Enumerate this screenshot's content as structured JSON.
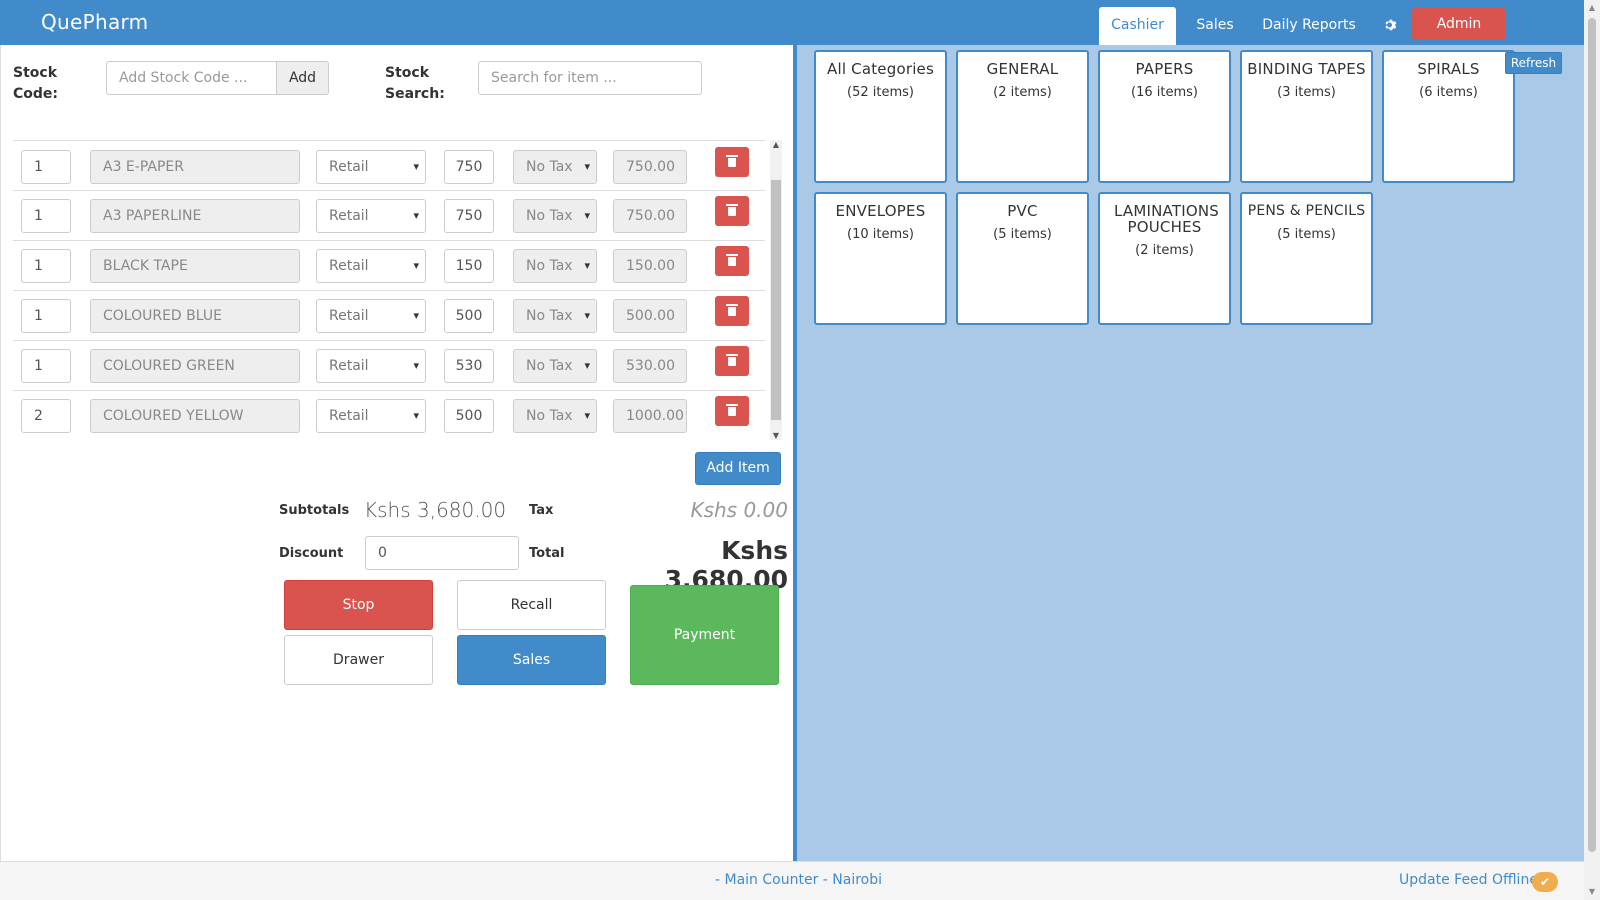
{
  "app": {
    "brand": "QuePharm"
  },
  "nav": {
    "tabs": [
      "Cashier",
      "Sales",
      "Daily Reports"
    ],
    "settings_icon": "gear-icon",
    "admin_label": "Admin"
  },
  "stock": {
    "code_label": "Stock Code:",
    "code_placeholder": "Add Stock Code ...",
    "add_label": "Add",
    "search_label": "Stock Search:",
    "search_placeholder": "Search for item ..."
  },
  "items": [
    {
      "qty": "1",
      "name": "A3 E-PAPER",
      "price_type": "Retail",
      "unit": "750",
      "tax": "No Tax",
      "total": "750.00"
    },
    {
      "qty": "1",
      "name": "A3 PAPERLINE",
      "price_type": "Retail",
      "unit": "750",
      "tax": "No Tax",
      "total": "750.00"
    },
    {
      "qty": "1",
      "name": "BLACK TAPE",
      "price_type": "Retail",
      "unit": "150",
      "tax": "No Tax",
      "total": "150.00"
    },
    {
      "qty": "1",
      "name": "COLOURED BLUE",
      "price_type": "Retail",
      "unit": "500",
      "tax": "No Tax",
      "total": "500.00"
    },
    {
      "qty": "1",
      "name": "COLOURED GREEN",
      "price_type": "Retail",
      "unit": "530",
      "tax": "No Tax",
      "total": "530.00"
    },
    {
      "qty": "2",
      "name": "COLOURED YELLOW",
      "price_type": "Retail",
      "unit": "500",
      "tax": "No Tax",
      "total": "1000.00"
    }
  ],
  "add_item_label": "Add Item",
  "totals": {
    "subtotals_label": "Subtotals",
    "subtotals_value": "Kshs 3,680.00",
    "tax_label": "Tax",
    "tax_value": "Kshs 0.00",
    "discount_label": "Discount",
    "discount_value": "0",
    "total_label": "Total",
    "total_value": "Kshs 3,680.00"
  },
  "actions": {
    "stop": "Stop",
    "recall": "Recall",
    "drawer": "Drawer",
    "sales": "Sales",
    "payment": "Payment"
  },
  "categories": [
    {
      "name": "All Categories",
      "count": "(52 items)"
    },
    {
      "name": "GENERAL",
      "count": "(2 items)"
    },
    {
      "name": "PAPERS",
      "count": "(16 items)"
    },
    {
      "name": "BINDING TAPES",
      "count": "(3 items)"
    },
    {
      "name": "SPIRALS",
      "count": "(6 items)"
    },
    {
      "name": "ENVELOPES",
      "count": "(10 items)"
    },
    {
      "name": "PVC",
      "count": "(5 items)"
    },
    {
      "name": "LAMINATIONS POUCHES",
      "count": "(2 items)"
    },
    {
      "name": "PENS & PENCILS",
      "count": "(5 items)"
    }
  ],
  "refresh_label": "Refresh",
  "footer": {
    "location": "- Main Counter - Nairobi",
    "feed_status": "Update Feed Offline",
    "status_icon": "check-icon"
  },
  "colors": {
    "primary": "#428bca",
    "danger": "#d9534f",
    "success": "#5cb85c",
    "panel": "#a9c9e6",
    "warning": "#f0ad4e"
  }
}
